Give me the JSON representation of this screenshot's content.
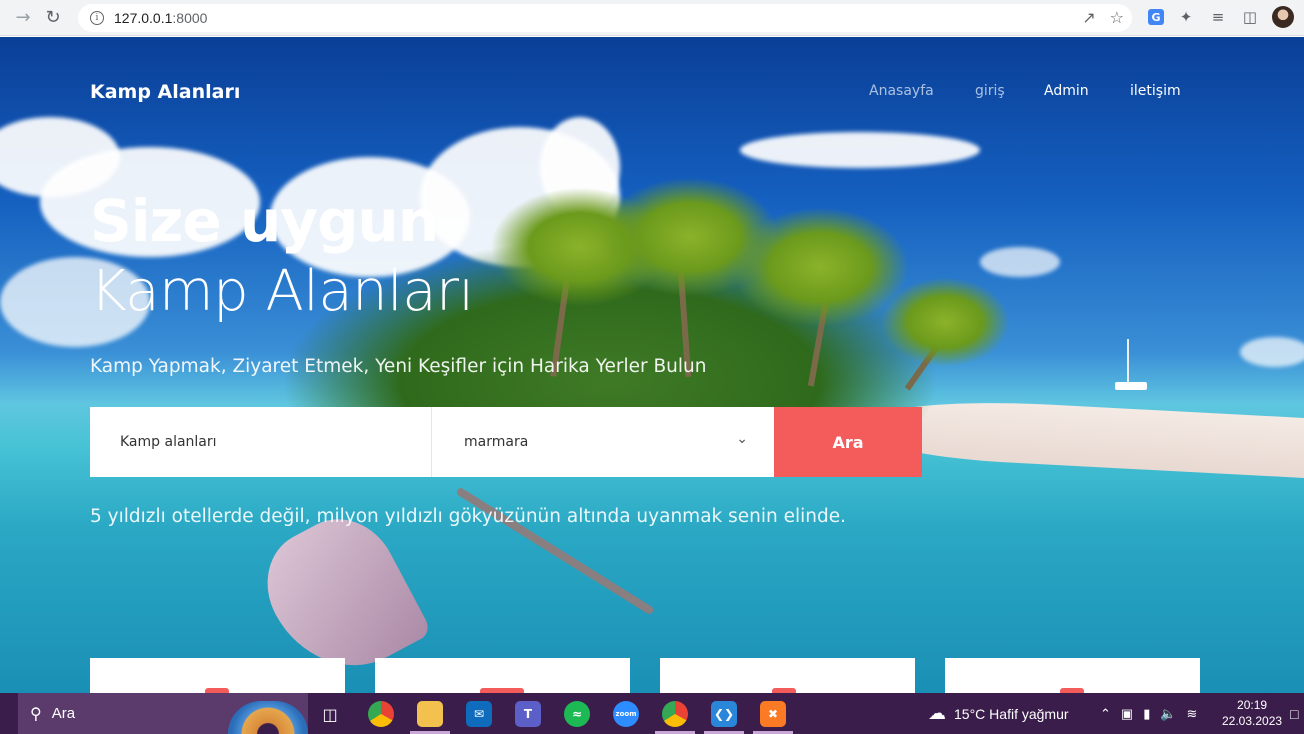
{
  "browser": {
    "url_host": "127.0.0.1",
    "url_port": ":8000",
    "icons": [
      "back-arrow-icon",
      "reload-icon",
      "info-icon",
      "share-icon",
      "star-icon",
      "translate-icon",
      "extensions-icon",
      "reading-list-icon",
      "side-panel-icon",
      "profile-avatar"
    ]
  },
  "site": {
    "brand": "Kamp Alanları",
    "nav": [
      "Anasayfa",
      "giriş",
      "Admin",
      "iletişim"
    ]
  },
  "hero": {
    "title_bold": "Size uygun",
    "title_light": "Kamp Alanları",
    "subtitle": "Kamp Yapmak, Ziyaret Etmek, Yeni Keşifler için Harika Yerler Bulun",
    "tagline": "5 yıldızlı otellerde değil, milyon yıldızlı gökyüzünün altında uyanmak senin elinde."
  },
  "search": {
    "input_placeholder": "Kamp alanları",
    "select_value": "marmara",
    "button_label": "Ara"
  },
  "taskbar": {
    "search_label": "Ara",
    "weather": "15°C  Hafif yağmur",
    "time": "20:19",
    "date": "22.03.2023"
  },
  "colors": {
    "accent": "#f45c5c",
    "taskbar": "#3a1d4a"
  }
}
